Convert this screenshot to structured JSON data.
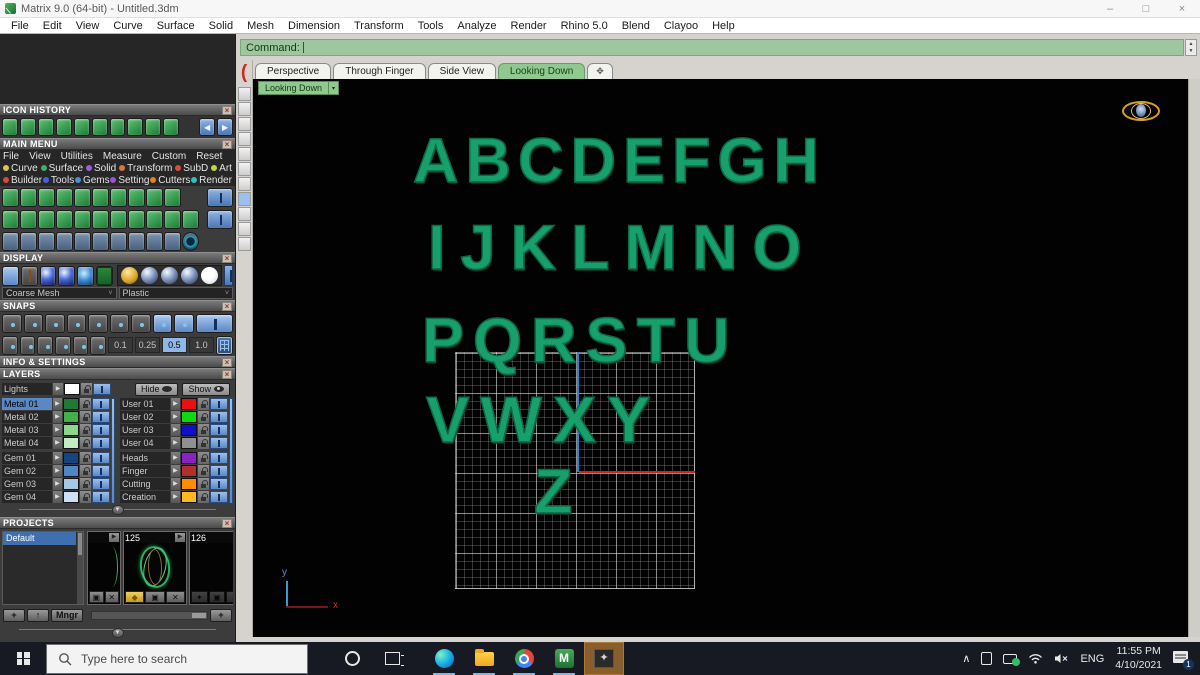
{
  "window": {
    "title": "Matrix 9.0 (64-bit) - Untitled.3dm",
    "controls": {
      "minimize": "–",
      "maximize": "□",
      "close": "×"
    }
  },
  "menu_bar": [
    "File",
    "Edit",
    "View",
    "Curve",
    "Surface",
    "Solid",
    "Mesh",
    "Dimension",
    "Transform",
    "Tools",
    "Analyze",
    "Render",
    "Rhino 5.0",
    "Blend",
    "Clayoo",
    "Help"
  ],
  "glyphs": {
    "close": "×",
    "back": "◀",
    "forward": "▶",
    "play": "▶",
    "caret_down": "▼",
    "caret_up": "▲",
    "divider_caret": "▼",
    "paren": "(",
    "plus_tab": "✥",
    "chevron_up": "∧",
    "mute": "🕩",
    "select_caret": "▾"
  },
  "icon_history": {
    "title": "ICON HISTORY"
  },
  "main_menu": {
    "title": "MAIN MENU",
    "row1": [
      "File",
      "View",
      "Utilities",
      "Measure",
      "Custom"
    ],
    "reset_label": "Reset",
    "row2": [
      {
        "label": "Curve",
        "color": "#d8c84a"
      },
      {
        "label": "Surface",
        "color": "#3fae6a"
      },
      {
        "label": "Solid",
        "color": "#9a5fd8"
      },
      {
        "label": "Transform",
        "color": "#d8763f"
      },
      {
        "label": "SubD",
        "color": "#d84a3f"
      },
      {
        "label": "Art",
        "color": "#bcd83f"
      }
    ],
    "row3": [
      {
        "label": "Builder",
        "color": "#d84a3f"
      },
      {
        "label": "Tools",
        "color": "#4a5fd8"
      },
      {
        "label": "Gems",
        "color": "#4a8fd8"
      },
      {
        "label": "Setting",
        "color": "#a04fd8"
      },
      {
        "label": "Cutters",
        "color": "#e8821e"
      },
      {
        "label": "Render",
        "color": "#2fc0c0"
      }
    ]
  },
  "display": {
    "title": "DISPLAY",
    "mesh_mode": "Coarse Mesh",
    "material_mode": "Plastic"
  },
  "snaps": {
    "title": "SNAPS",
    "grid_values": [
      "0.1",
      "0.25",
      "0.5",
      "1.0"
    ],
    "selected_value": "0.5"
  },
  "info_settings": {
    "title": "INFO & SETTINGS"
  },
  "layers": {
    "title": "LAYERS",
    "lights": {
      "label": "Lights",
      "color": "#ffffff"
    },
    "hide_label": "Hide",
    "show_label": "Show",
    "left_column": [
      {
        "label": "Metal 01",
        "color": "#1e7a34",
        "selected": true
      },
      {
        "label": "Metal 02",
        "color": "#45b049",
        "selected": false
      },
      {
        "label": "Metal 03",
        "color": "#8bd88b",
        "selected": false
      },
      {
        "label": "Metal 04",
        "color": "#c4ecc4",
        "selected": false
      },
      {
        "label": "Gem 01",
        "color": "#15457f",
        "selected": false
      },
      {
        "label": "Gem 02",
        "color": "#4f86c6",
        "selected": false
      },
      {
        "label": "Gem 03",
        "color": "#a6c8e8",
        "selected": false
      },
      {
        "label": "Gem 04",
        "color": "#cfe0f4",
        "selected": false
      }
    ],
    "right_column": [
      {
        "label": "User 01",
        "color": "#e81010",
        "selected": false
      },
      {
        "label": "User 02",
        "color": "#10d810",
        "selected": false
      },
      {
        "label": "User 03",
        "color": "#1010c8",
        "selected": false
      },
      {
        "label": "User 04",
        "color": "#909090",
        "selected": false
      },
      {
        "label": "Heads",
        "color": "#8922c2",
        "selected": false
      },
      {
        "label": "Finger",
        "color": "#b03030",
        "selected": false
      },
      {
        "label": "Cutting",
        "color": "#ff8c00",
        "selected": false
      },
      {
        "label": "Creation",
        "color": "#ffb920",
        "selected": false
      }
    ]
  },
  "projects": {
    "title": "PROJECTS",
    "list": [
      {
        "label": "Default",
        "selected": true
      }
    ],
    "thumbnails": [
      {
        "label": ""
      },
      {
        "label": "125"
      },
      {
        "label": "126"
      }
    ],
    "icons": {
      "save": "▣",
      "delete": "✕",
      "gem": "◆",
      "add": "✦"
    },
    "add_label": "+",
    "up_label": "↑",
    "manager_label": "Mngr",
    "hplus_label": "+"
  },
  "command_bar": {
    "label": "Command:"
  },
  "viewport": {
    "tabs": [
      {
        "label": "Perspective",
        "active": false
      },
      {
        "label": "Through Finger",
        "active": false
      },
      {
        "label": "Side View",
        "active": false
      },
      {
        "label": "Looking Down",
        "active": true
      }
    ],
    "view_label": "Looking Down",
    "letter_rows": [
      [
        "A",
        "B",
        "C",
        "D",
        "E",
        "F",
        "G",
        "H"
      ],
      [
        "I",
        "J",
        "K",
        "L",
        "M",
        "N",
        "O"
      ],
      [
        "P",
        "Q",
        "R",
        "S",
        "T",
        "U"
      ],
      [
        "V",
        "W",
        "X",
        "Y"
      ],
      [
        "Z"
      ]
    ],
    "axes": {
      "x_label": "x",
      "y_label": "y"
    }
  },
  "taskbar": {
    "search_placeholder": "Type here to search",
    "matrix_logo": "M",
    "render_glyph": "✦",
    "tray": {
      "language": "ENG",
      "time": "11:55 PM",
      "date": "4/10/2021",
      "notification_count": "1"
    }
  }
}
